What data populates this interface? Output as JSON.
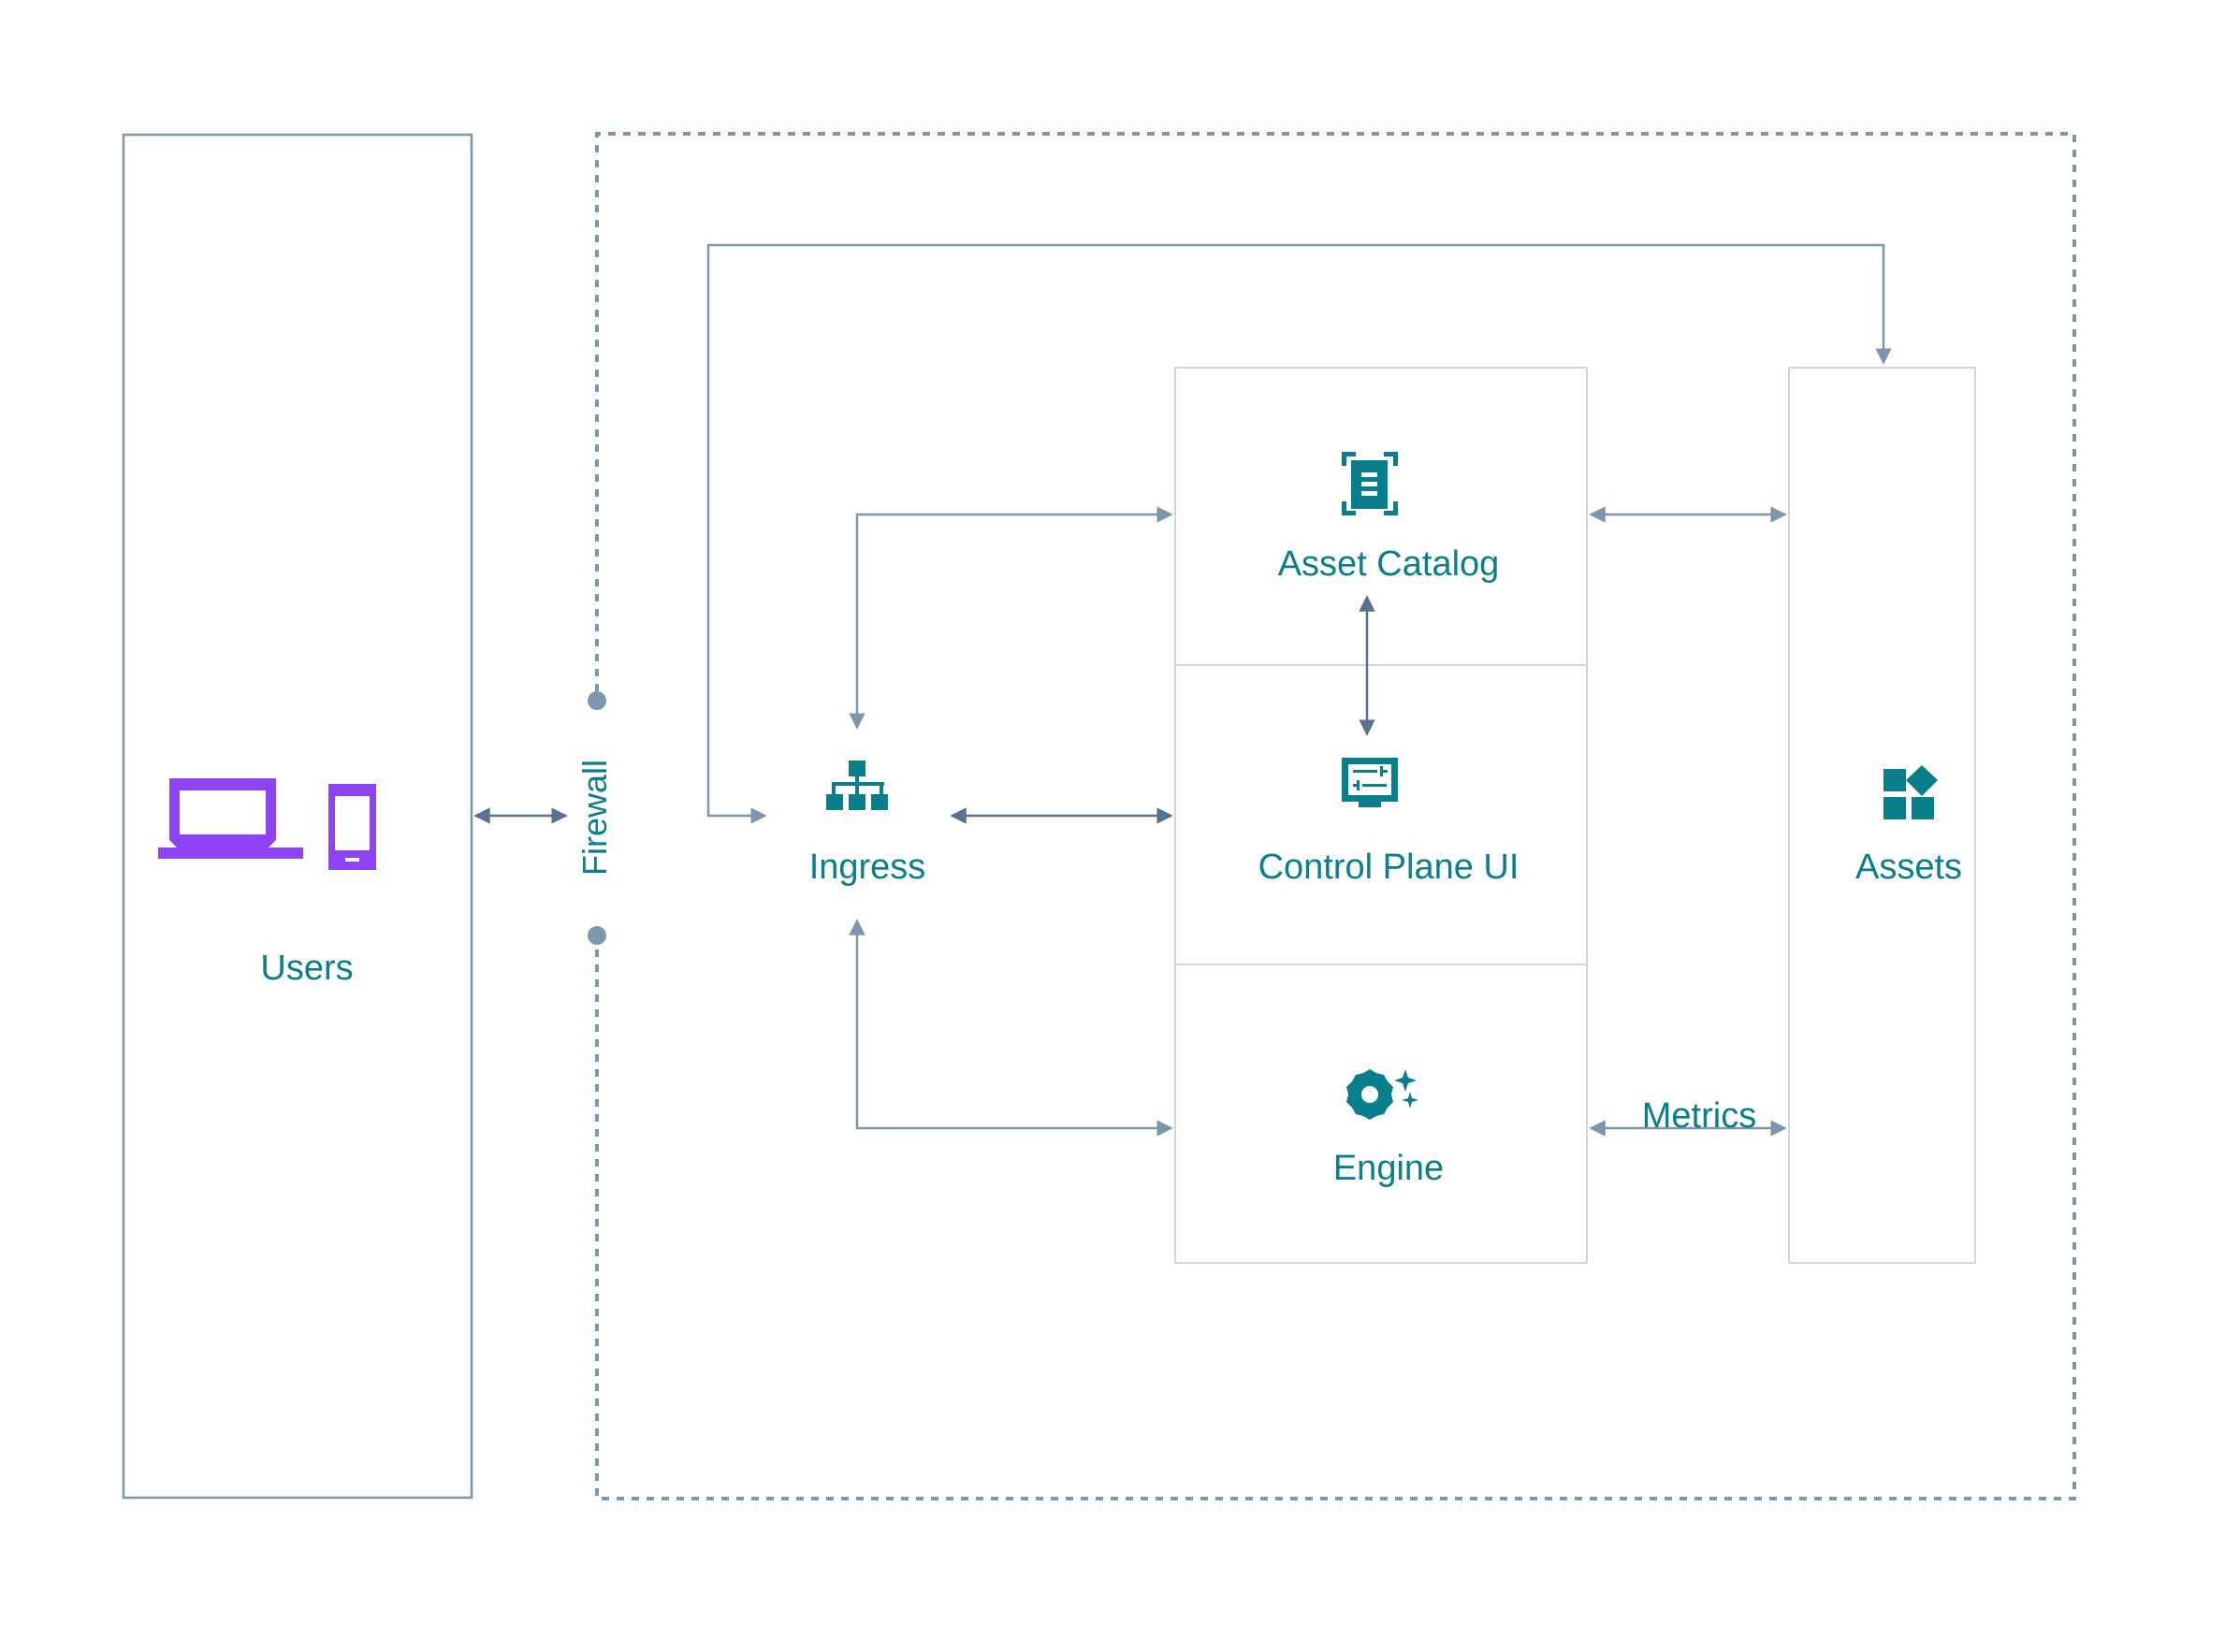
{
  "diagram": {
    "colors": {
      "accent_text": "#0a7f8c",
      "icon_teal": "#0a7f8c",
      "user_icon_purple": "#8e44f5",
      "connector": "#7d95ad",
      "connector_dark": "#56728e",
      "box_border": "#d0d6df",
      "outer_border": "#7d95ad"
    },
    "nodes": {
      "users": {
        "label": "Users",
        "icons": [
          "laptop-icon",
          "mobile-phone-icon"
        ]
      },
      "firewall": {
        "label": "Firewall"
      },
      "ingress": {
        "label": "Ingress",
        "icon": "sitemap-icon"
      },
      "asset_catalog": {
        "label": "Asset Catalog",
        "icon": "document-scan-icon"
      },
      "control_plane_ui": {
        "label": "Control Plane UI",
        "icon": "monitor-settings-icon"
      },
      "engine": {
        "label": "Engine",
        "icon": "gear-sparkle-icon"
      },
      "assets": {
        "label": "Assets",
        "icon": "widgets-icon"
      }
    },
    "edges": [
      {
        "from": "users",
        "to": "firewall",
        "label": ""
      },
      {
        "from": "assets",
        "to": "ingress",
        "label": ""
      },
      {
        "from": "asset_catalog",
        "to": "ingress",
        "label": ""
      },
      {
        "from": "ingress",
        "to": "control_plane_ui",
        "label": ""
      },
      {
        "from": "engine",
        "to": "ingress",
        "label": ""
      },
      {
        "from": "asset_catalog",
        "to": "control_plane_ui",
        "label": ""
      },
      {
        "from": "assets",
        "to": "asset_catalog",
        "label": ""
      },
      {
        "from": "assets",
        "to": "engine",
        "label": "Metrics"
      }
    ]
  }
}
